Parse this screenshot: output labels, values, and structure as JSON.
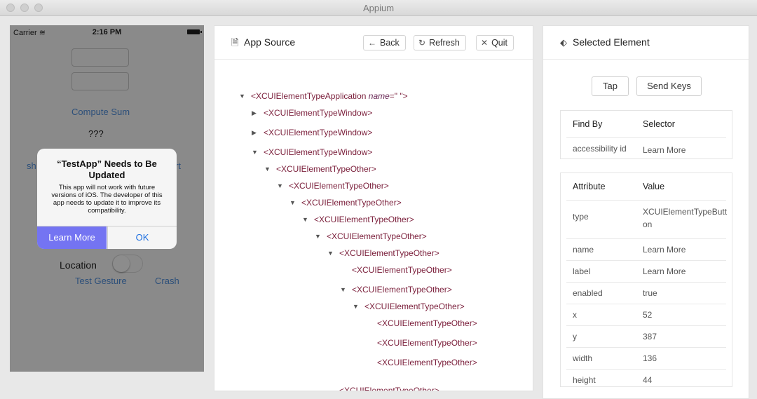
{
  "window": {
    "title": "Appium"
  },
  "simulator": {
    "carrier": "Carrier",
    "time": "2:16 PM",
    "compute_sum": "Compute Sum",
    "result": "???",
    "show_partial": "sh",
    "alert_partial": "rt",
    "location_label": "Location",
    "test_gesture": "Test Gesture",
    "crash": "Crash",
    "alert": {
      "title": "“TestApp” Needs to Be Updated",
      "message": "This app will not work with future versions of iOS. The developer of this app needs to update it to improve its compatibility.",
      "learn_more": "Learn More",
      "ok": "OK"
    }
  },
  "app_source": {
    "title": "App Source",
    "back": "Back",
    "refresh": "Refresh",
    "quit": "Quit",
    "tree": [
      {
        "tag": "<XCUIElementTypeApplication",
        "attr": "name",
        "attr_value": "=\" \">",
        "arrow": "down"
      },
      {
        "tag": "<XCUIElementTypeWindow>",
        "arrow": "right"
      },
      {
        "tag": "<XCUIElementTypeWindow>",
        "arrow": "right"
      },
      {
        "tag": "<XCUIElementTypeWindow>",
        "arrow": "down"
      },
      {
        "tag": "<XCUIElementTypeOther>",
        "arrow": "down"
      },
      {
        "tag": "<XCUIElementTypeOther>",
        "arrow": "down"
      },
      {
        "tag": "<XCUIElementTypeOther>",
        "arrow": "down"
      },
      {
        "tag": "<XCUIElementTypeOther>",
        "arrow": "down"
      },
      {
        "tag": "<XCUIElementTypeOther>",
        "arrow": "down"
      },
      {
        "tag": "<XCUIElementTypeOther>",
        "arrow": "down"
      },
      {
        "tag": "<XCUIElementTypeOther>",
        "arrow": "none"
      },
      {
        "tag": "<XCUIElementTypeOther>",
        "arrow": "down"
      },
      {
        "tag": "<XCUIElementTypeOther>",
        "arrow": "down"
      },
      {
        "tag": "<XCUIElementTypeOther>",
        "arrow": "none"
      },
      {
        "tag": "<XCUIElementTypeOther>",
        "arrow": "none"
      },
      {
        "tag": "<XCUIElementTypeOther>",
        "arrow": "none"
      },
      {
        "tag": "<XCUIElementTypeOther>",
        "arrow": "none"
      }
    ]
  },
  "selected_element": {
    "title": "Selected Element",
    "tap": "Tap",
    "send_keys": "Send Keys",
    "find_by": {
      "header_key": "Find By",
      "header_value": "Selector",
      "rows": [
        {
          "key": "accessibility id",
          "value": "Learn More"
        }
      ]
    },
    "attributes": {
      "header_key": "Attribute",
      "header_value": "Value",
      "rows": [
        {
          "key": "type",
          "value": "XCUIElementTypeButton"
        },
        {
          "key": "name",
          "value": "Learn More"
        },
        {
          "key": "label",
          "value": "Learn More"
        },
        {
          "key": "enabled",
          "value": "true"
        },
        {
          "key": "x",
          "value": "52"
        },
        {
          "key": "y",
          "value": "387"
        },
        {
          "key": "width",
          "value": "136"
        },
        {
          "key": "height",
          "value": "44"
        }
      ]
    }
  }
}
